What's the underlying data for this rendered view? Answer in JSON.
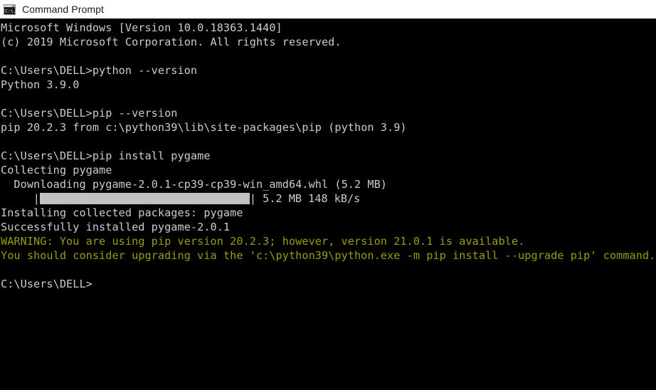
{
  "window": {
    "title": "Command Prompt",
    "icon": "cmd-icon",
    "titlebar_bg": "#ffffff",
    "titlebar_text_color": "#1a1a1a"
  },
  "console": {
    "bg_color": "#000000",
    "text_color": "#cccccc",
    "warning_color": "#9a9a11",
    "lines": [
      {
        "text": "Microsoft Windows [Version 10.0.18363.1440]",
        "type": "output"
      },
      {
        "text": "(c) 2019 Microsoft Corporation. All rights reserved.",
        "type": "output"
      },
      {
        "text": "",
        "type": "blank"
      },
      {
        "text": "C:\\Users\\DELL>python --version",
        "type": "prompt"
      },
      {
        "text": "Python 3.9.0",
        "type": "output"
      },
      {
        "text": "",
        "type": "blank"
      },
      {
        "text": "C:\\Users\\DELL>pip --version",
        "type": "prompt"
      },
      {
        "text": "pip 20.2.3 from c:\\python39\\lib\\site-packages\\pip (python 3.9)",
        "type": "output"
      },
      {
        "text": "",
        "type": "blank"
      },
      {
        "text": "C:\\Users\\DELL>pip install pygame",
        "type": "prompt"
      },
      {
        "text": "Collecting pygame",
        "type": "output"
      },
      {
        "text": "  Downloading pygame-2.0.1-cp39-cp39-win_amd64.whl (5.2 MB)",
        "type": "output"
      },
      {
        "text": "",
        "type": "progress"
      },
      {
        "text": "Installing collected packages: pygame",
        "type": "output"
      },
      {
        "text": "Successfully installed pygame-2.0.1",
        "type": "output"
      },
      {
        "text": "WARNING: You are using pip version 20.2.3; however, version 21.0.1 is available.",
        "type": "warning"
      },
      {
        "text": "You should consider upgrading via the 'c:\\python39\\python.exe -m pip install --upgrade pip' command.",
        "type": "warning"
      },
      {
        "text": "",
        "type": "blank"
      },
      {
        "text": "C:\\Users\\DELL>",
        "type": "prompt"
      }
    ],
    "progress": {
      "indent": "     ",
      "left_bracket": "|",
      "right_bracket": "|",
      "percent": 100,
      "fill_color": "#c2c2c2",
      "downloaded": "5.2 MB",
      "speed": "148 kB/s",
      "trailing_text": " 5.2 MB 148 kB/s"
    }
  }
}
